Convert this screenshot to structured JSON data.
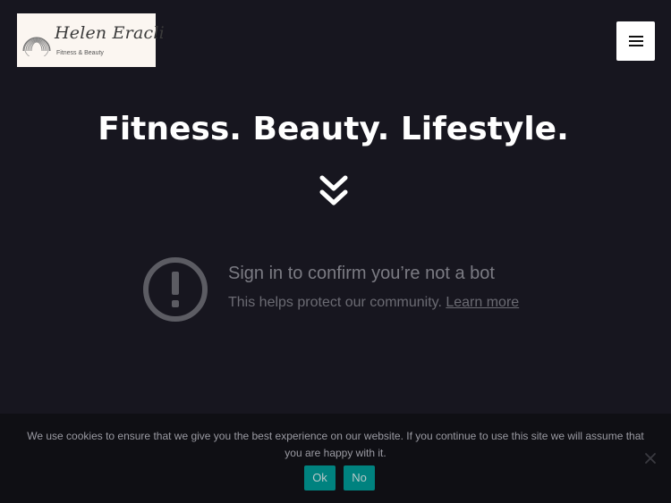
{
  "logo": {
    "name": "Helen Eracli",
    "tagline": "Fitness & Beauty"
  },
  "header": {
    "menu_icon": "hamburger-menu-icon"
  },
  "hero": {
    "headline": "Fitness. Beauty. Lifestyle.",
    "scroll_icon": "double-chevron-down-icon"
  },
  "bot_notice": {
    "icon": "exclamation-circle-icon",
    "title": "Sign in to confirm you’re not a bot",
    "subtitle": "This helps protect our community.",
    "link_label": "Learn more"
  },
  "cookie_bar": {
    "message": "We use cookies to ensure that we give you the best experience on our website. If you continue to use this site we will assume that you are happy with it.",
    "ok_label": "Ok",
    "no_label": "No",
    "close_icon": "close-icon"
  },
  "colors": {
    "background": "#17161f",
    "cookie_button": "#00827f",
    "headline": "#ffffff"
  }
}
